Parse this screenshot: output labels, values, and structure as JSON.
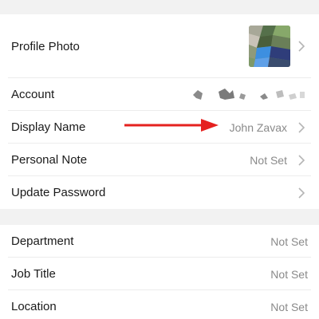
{
  "profile": {
    "photo_label": "Profile Photo",
    "account_label": "Account",
    "display_name_label": "Display Name",
    "display_name_value": "John Zavax",
    "personal_note_label": "Personal Note",
    "personal_note_value": "Not Set",
    "update_password_label": "Update Password"
  },
  "work": {
    "department_label": "Department",
    "department_value": "Not Set",
    "job_title_label": "Job Title",
    "job_title_value": "Not Set",
    "location_label": "Location",
    "location_value": "Not Set"
  },
  "colors": {
    "accent_arrow": "#e5211f",
    "chevron": "#b5b5b5",
    "value_text": "#8a8a8a"
  },
  "icons": {
    "chevron": "chevron-right-icon",
    "arrow": "red-arrow-annotation-icon"
  }
}
